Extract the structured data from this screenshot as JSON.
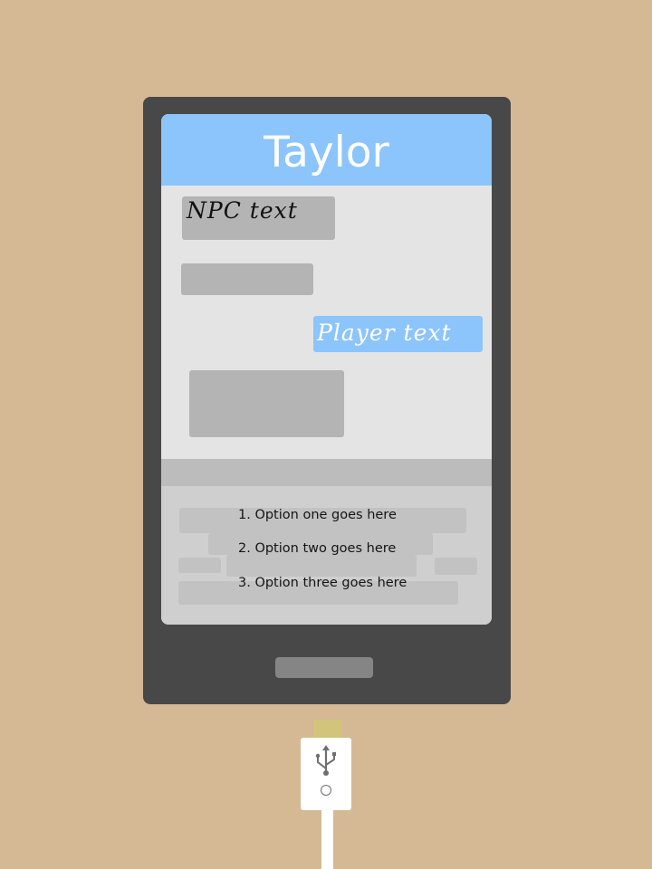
{
  "header": {
    "contact_name": "Taylor"
  },
  "conversation": {
    "messages": [
      {
        "speaker": "npc",
        "text": "NPC text"
      },
      {
        "speaker": "npc",
        "text": ""
      },
      {
        "speaker": "player",
        "text": "Player text"
      },
      {
        "speaker": "npc",
        "text": ""
      }
    ]
  },
  "options": [
    {
      "label": "1. Option one goes here"
    },
    {
      "label": "2. Option two goes here"
    },
    {
      "label": "3. Option three goes here"
    }
  ],
  "colors": {
    "background": "#d4b994",
    "phone_body": "#484848",
    "header": "#8cc4fc",
    "npc_bubble": "#b4b4b4",
    "player_bubble": "#8cc4fc",
    "chat_background": "#e4e4e4",
    "options_background": "#cfcfcf"
  },
  "icons": {
    "cable_connector": "usb-icon"
  }
}
